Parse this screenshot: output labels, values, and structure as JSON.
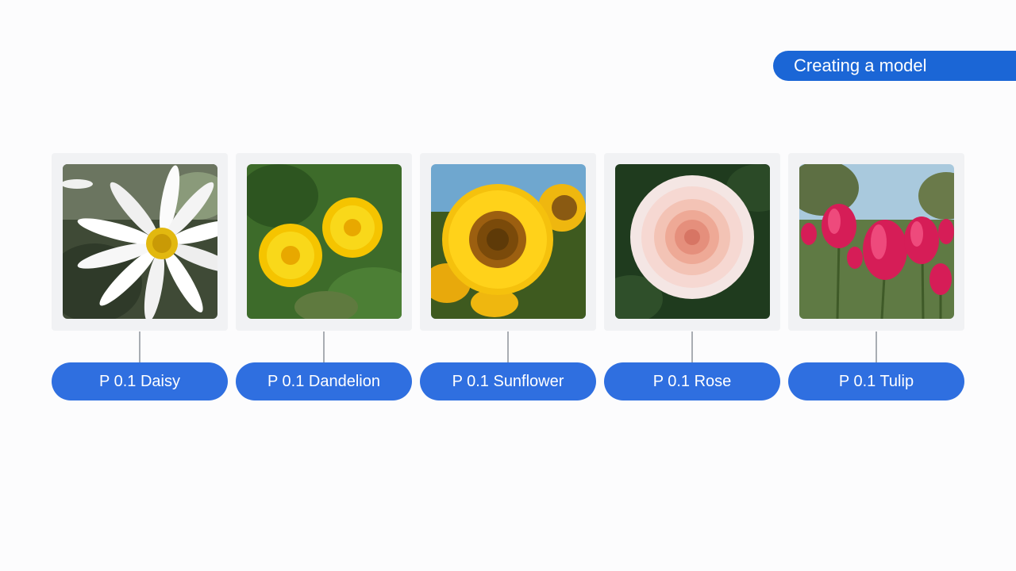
{
  "header": {
    "section_label": "Creating a model"
  },
  "classes": [
    {
      "label": "P 0.1 Daisy",
      "image": "daisy-photo"
    },
    {
      "label": "P 0.1 Dandelion",
      "image": "dandelion-photo"
    },
    {
      "label": "P 0.1 Sunflower",
      "image": "sunflower-photo"
    },
    {
      "label": "P 0.1 Rose",
      "image": "rose-photo"
    },
    {
      "label": "P 0.1 Tulip",
      "image": "tulip-photo"
    }
  ],
  "colors": {
    "accent": "#1b66d6",
    "pill": "#2f6fe0",
    "card_bg": "#f1f2f4",
    "connector": "#a9adb3"
  }
}
